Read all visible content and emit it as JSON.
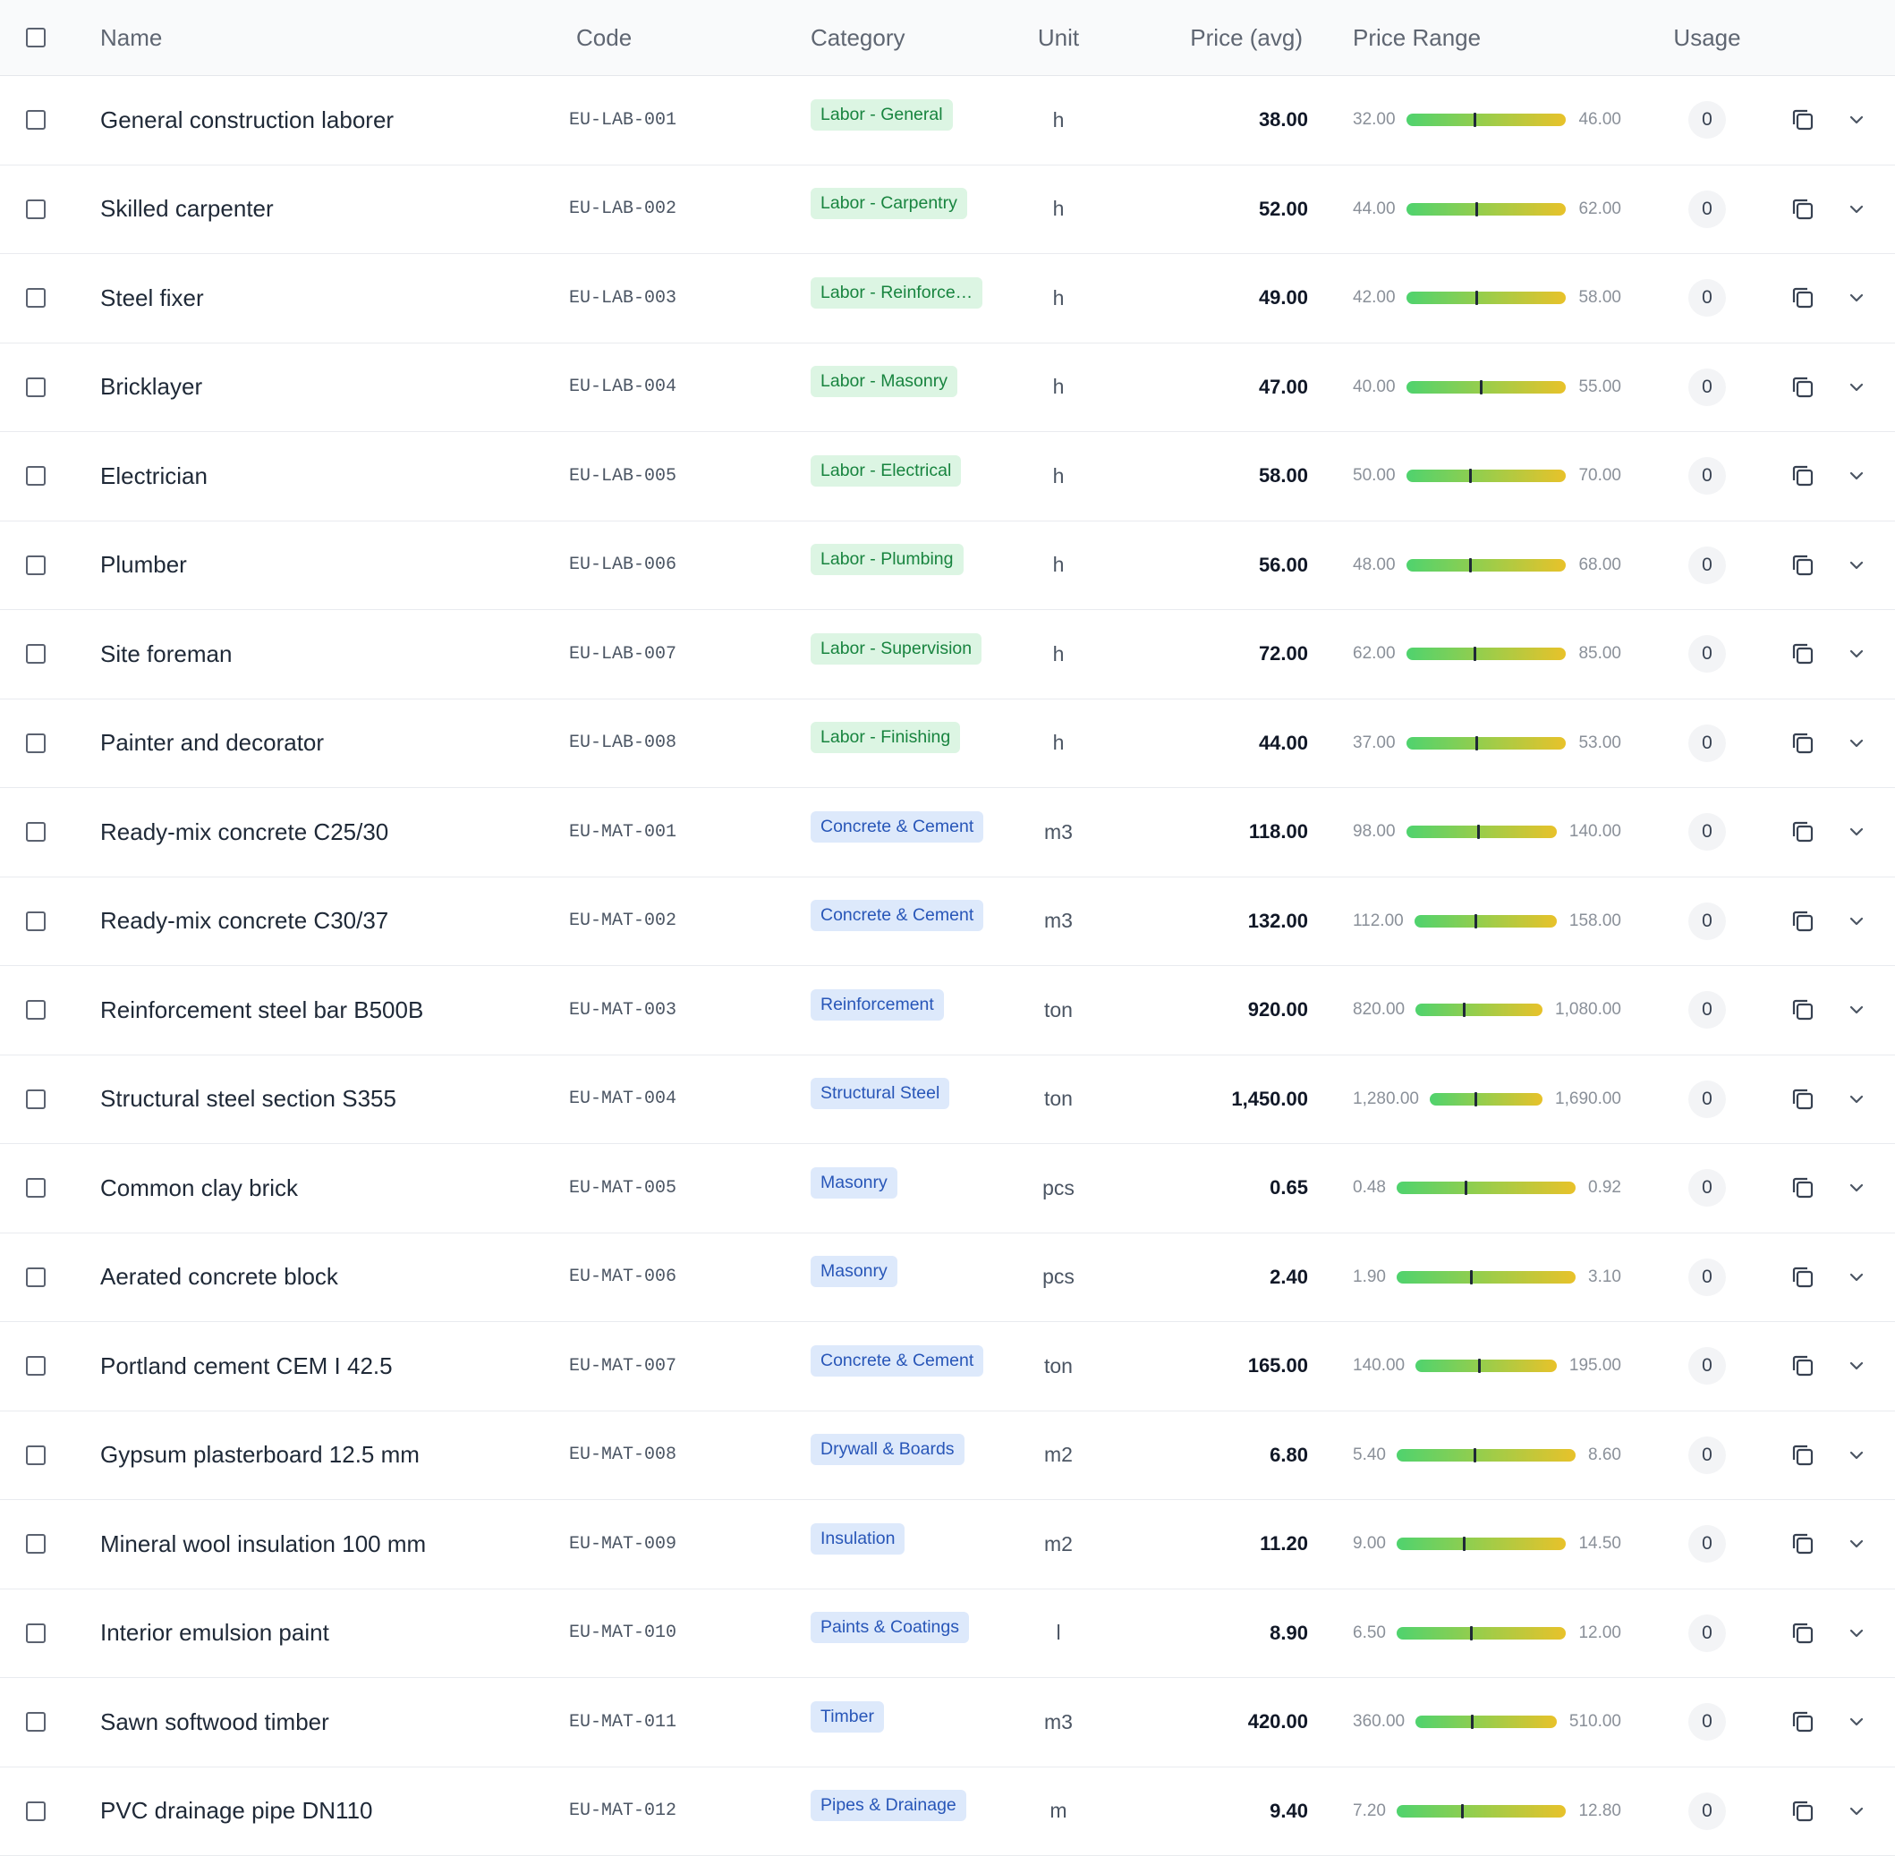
{
  "header": {
    "name": "Name",
    "code": "Code",
    "category": "Category",
    "unit": "Unit",
    "price": "Price (avg)",
    "range": "Price Range",
    "usage": "Usage"
  },
  "colors": {
    "labor_badge_bg": "#dcf5e3",
    "labor_badge_text": "#18843f",
    "material_badge_bg": "#dde9fb",
    "material_badge_text": "#2856b8",
    "range_gradient_start": "#4fd36e",
    "range_gradient_end": "#e8c22a"
  },
  "icons": {
    "copy": "copy-icon",
    "expand": "chevron-down-icon",
    "select": "checkbox"
  },
  "rows": [
    {
      "name": "General construction laborer",
      "code": "EU-LAB-001",
      "category": "Labor - General",
      "kind": "labor",
      "unit": "h",
      "price": "38.00",
      "min": "32.00",
      "max": "46.00",
      "avg_fraction": 0.43,
      "usage": "0"
    },
    {
      "name": "Skilled carpenter",
      "code": "EU-LAB-002",
      "category": "Labor - Carpentry",
      "kind": "labor",
      "unit": "h",
      "price": "52.00",
      "min": "44.00",
      "max": "62.00",
      "avg_fraction": 0.44,
      "usage": "0"
    },
    {
      "name": "Steel fixer",
      "code": "EU-LAB-003",
      "category": "Labor - Reinforce…",
      "kind": "labor",
      "unit": "h",
      "price": "49.00",
      "min": "42.00",
      "max": "58.00",
      "avg_fraction": 0.44,
      "usage": "0"
    },
    {
      "name": "Bricklayer",
      "code": "EU-LAB-004",
      "category": "Labor - Masonry",
      "kind": "labor",
      "unit": "h",
      "price": "47.00",
      "min": "40.00",
      "max": "55.00",
      "avg_fraction": 0.47,
      "usage": "0"
    },
    {
      "name": "Electrician",
      "code": "EU-LAB-005",
      "category": "Labor - Electrical",
      "kind": "labor",
      "unit": "h",
      "price": "58.00",
      "min": "50.00",
      "max": "70.00",
      "avg_fraction": 0.4,
      "usage": "0"
    },
    {
      "name": "Plumber",
      "code": "EU-LAB-006",
      "category": "Labor - Plumbing",
      "kind": "labor",
      "unit": "h",
      "price": "56.00",
      "min": "48.00",
      "max": "68.00",
      "avg_fraction": 0.4,
      "usage": "0"
    },
    {
      "name": "Site foreman",
      "code": "EU-LAB-007",
      "category": "Labor - Supervision",
      "kind": "labor",
      "unit": "h",
      "price": "72.00",
      "min": "62.00",
      "max": "85.00",
      "avg_fraction": 0.43,
      "usage": "0"
    },
    {
      "name": "Painter and decorator",
      "code": "EU-LAB-008",
      "category": "Labor - Finishing",
      "kind": "labor",
      "unit": "h",
      "price": "44.00",
      "min": "37.00",
      "max": "53.00",
      "avg_fraction": 0.44,
      "usage": "0"
    },
    {
      "name": "Ready-mix concrete C25/30",
      "code": "EU-MAT-001",
      "category": "Concrete & Cement",
      "kind": "material",
      "unit": "m3",
      "price": "118.00",
      "min": "98.00",
      "max": "140.00",
      "avg_fraction": 0.48,
      "usage": "0"
    },
    {
      "name": "Ready-mix concrete C30/37",
      "code": "EU-MAT-002",
      "category": "Concrete & Cement",
      "kind": "material",
      "unit": "m3",
      "price": "132.00",
      "min": "112.00",
      "max": "158.00",
      "avg_fraction": 0.43,
      "usage": "0"
    },
    {
      "name": "Reinforcement steel bar B500B",
      "code": "EU-MAT-003",
      "category": "Reinforcement",
      "kind": "material",
      "unit": "ton",
      "price": "920.00",
      "min": "820.00",
      "max": "1,080.00",
      "avg_fraction": 0.38,
      "usage": "0"
    },
    {
      "name": "Structural steel section S355",
      "code": "EU-MAT-004",
      "category": "Structural Steel",
      "kind": "material",
      "unit": "ton",
      "price": "1,450.00",
      "min": "1,280.00",
      "max": "1,690.00",
      "avg_fraction": 0.41,
      "usage": "0"
    },
    {
      "name": "Common clay brick",
      "code": "EU-MAT-005",
      "category": "Masonry",
      "kind": "material",
      "unit": "pcs",
      "price": "0.65",
      "min": "0.48",
      "max": "0.92",
      "avg_fraction": 0.39,
      "usage": "0"
    },
    {
      "name": "Aerated concrete block",
      "code": "EU-MAT-006",
      "category": "Masonry",
      "kind": "material",
      "unit": "pcs",
      "price": "2.40",
      "min": "1.90",
      "max": "3.10",
      "avg_fraction": 0.42,
      "usage": "0"
    },
    {
      "name": "Portland cement CEM I 42.5",
      "code": "EU-MAT-007",
      "category": "Concrete & Cement",
      "kind": "material",
      "unit": "ton",
      "price": "165.00",
      "min": "140.00",
      "max": "195.00",
      "avg_fraction": 0.45,
      "usage": "0"
    },
    {
      "name": "Gypsum plasterboard 12.5 mm",
      "code": "EU-MAT-008",
      "category": "Drywall & Boards",
      "kind": "material",
      "unit": "m2",
      "price": "6.80",
      "min": "5.40",
      "max": "8.60",
      "avg_fraction": 0.44,
      "usage": "0"
    },
    {
      "name": "Mineral wool insulation 100 mm",
      "code": "EU-MAT-009",
      "category": "Insulation",
      "kind": "material",
      "unit": "m2",
      "price": "11.20",
      "min": "9.00",
      "max": "14.50",
      "avg_fraction": 0.4,
      "usage": "0"
    },
    {
      "name": "Interior emulsion paint",
      "code": "EU-MAT-010",
      "category": "Paints & Coatings",
      "kind": "material",
      "unit": "l",
      "price": "8.90",
      "min": "6.50",
      "max": "12.00",
      "avg_fraction": 0.44,
      "usage": "0"
    },
    {
      "name": "Sawn softwood timber",
      "code": "EU-MAT-011",
      "category": "Timber",
      "kind": "material",
      "unit": "m3",
      "price": "420.00",
      "min": "360.00",
      "max": "510.00",
      "avg_fraction": 0.4,
      "usage": "0"
    },
    {
      "name": "PVC drainage pipe DN110",
      "code": "EU-MAT-012",
      "category": "Pipes & Drainage",
      "kind": "material",
      "unit": "m",
      "price": "9.40",
      "min": "7.20",
      "max": "12.80",
      "avg_fraction": 0.39,
      "usage": "0"
    }
  ]
}
